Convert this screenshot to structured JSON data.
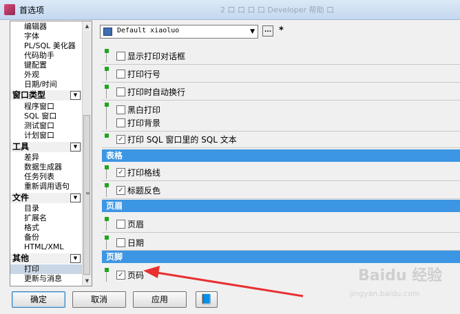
{
  "window": {
    "title": "首选项",
    "background_tabs": "2  口   口   口   口   Developer  帮助   口"
  },
  "nav": {
    "top_items": [
      "编辑器",
      "字体",
      "PL/SQL 美化器",
      "代码助手",
      "键配置",
      "外观",
      "日期/时间"
    ],
    "categories": [
      {
        "label": "窗口类型",
        "items": [
          "程序窗口",
          "SQL 窗口",
          "测试窗口",
          "计划窗口"
        ]
      },
      {
        "label": "工具",
        "items": [
          "差异",
          "数据生成器",
          "任务列表",
          "重新调用语句"
        ]
      },
      {
        "label": "文件",
        "items": [
          "目录",
          "扩展名",
          "格式",
          "备份",
          "HTML/XML"
        ]
      },
      {
        "label": "其他",
        "items": [
          "打印",
          "更新与消息"
        ]
      }
    ],
    "selected": "打印"
  },
  "preset": {
    "value": "Default xiaoluo",
    "more_label": "...",
    "modified_marker": "*"
  },
  "options": {
    "show_print_dialog": {
      "label": "显示打印对话框",
      "checked": false
    },
    "print_line_numbers": {
      "label": "打印行号",
      "checked": false
    },
    "auto_wrap": {
      "label": "打印时自动换行",
      "checked": false
    },
    "black_white": {
      "label": "黑白打印",
      "checked": false
    },
    "print_background": {
      "label": "打印背景",
      "checked": false
    },
    "print_sql_text": {
      "label": "打印 SQL 窗口里的 SQL 文本",
      "checked": true
    },
    "print_grid": {
      "label": "打印格线",
      "checked": true
    },
    "header_inverse": {
      "label": "标题反色",
      "checked": true
    },
    "page_header": {
      "label": "页眉",
      "checked": false
    },
    "date": {
      "label": "日期",
      "checked": false
    },
    "page_number": {
      "label": "页码",
      "checked": true
    }
  },
  "sections": {
    "table": "表格",
    "header": "页眉",
    "footer": "页脚"
  },
  "buttons": {
    "ok": "确定",
    "cancel": "取消",
    "apply": "应用"
  },
  "colors": {
    "section_bar": "#3d96e3",
    "group_marker": "#1fa51f",
    "annotation_arrow": "#e83030"
  },
  "watermark": {
    "text": "Baidu 经验",
    "sub": "jingyan.baidu.com"
  }
}
